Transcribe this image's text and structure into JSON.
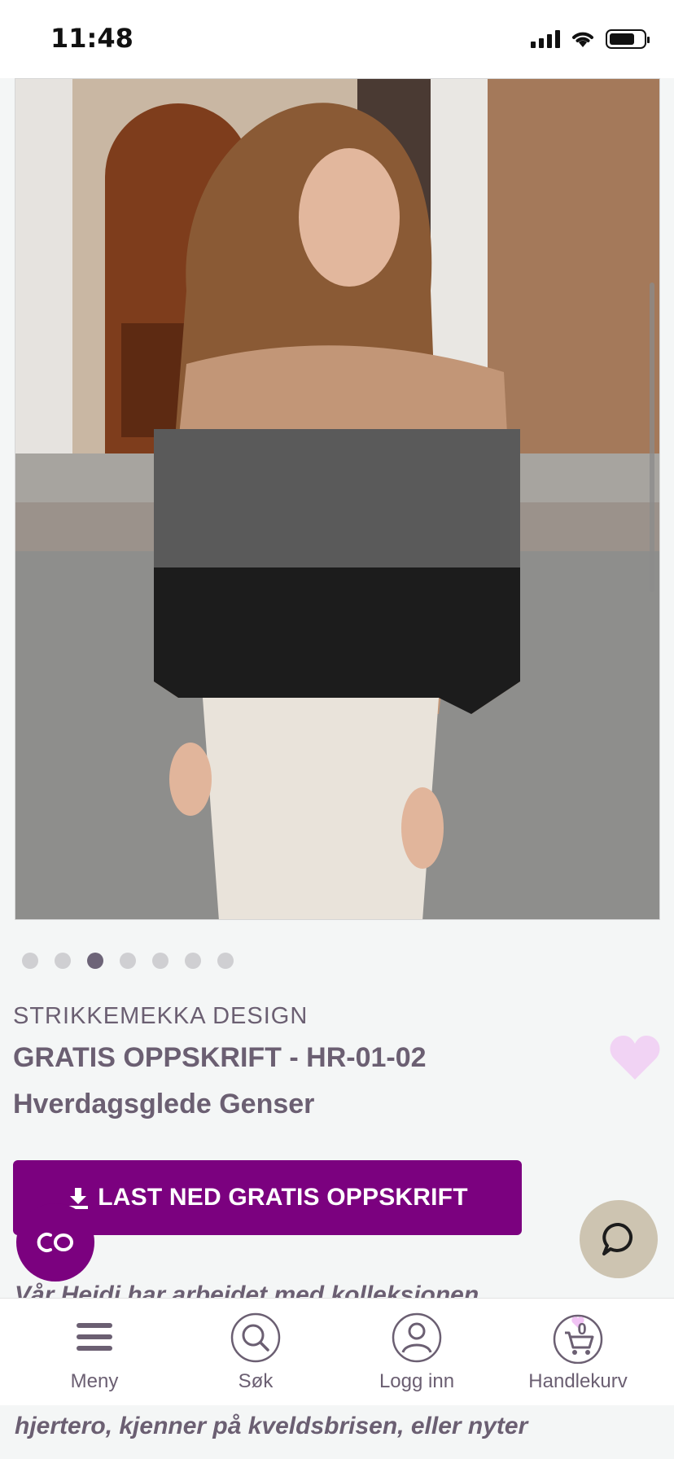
{
  "status_bar": {
    "time": "11:48"
  },
  "carousel": {
    "total": 7,
    "active_index": 2
  },
  "product": {
    "brand": "STRIKKEMEKKA DESIGN",
    "title": "GRATIS OPPSKRIFT - HR-01-02",
    "name": "Hverdagsglede Genser",
    "favorite_icon": "heart-icon",
    "favorite_color": "#f1d3f4"
  },
  "actions": {
    "download_label": "LAST NED GRATIS OPPSKRIFT",
    "download_icon": "download-icon",
    "accent_color": "#7b017f"
  },
  "floating": {
    "co_label": "CO",
    "chat_icon": "chat-bubble-icon"
  },
  "description": {
    "partial_line": "Vår Heidi har arbeidet med kolleksjonen",
    "line": "hjertero, kjenner på kveldsbrisen, eller nyter"
  },
  "bottom_nav": {
    "items": [
      {
        "label": "Meny",
        "icon": "menu-icon"
      },
      {
        "label": "Søk",
        "icon": "search-icon"
      },
      {
        "label": "Logg inn",
        "icon": "user-icon"
      },
      {
        "label": "Handlekurv",
        "icon": "cart-icon",
        "count": "0"
      }
    ]
  }
}
